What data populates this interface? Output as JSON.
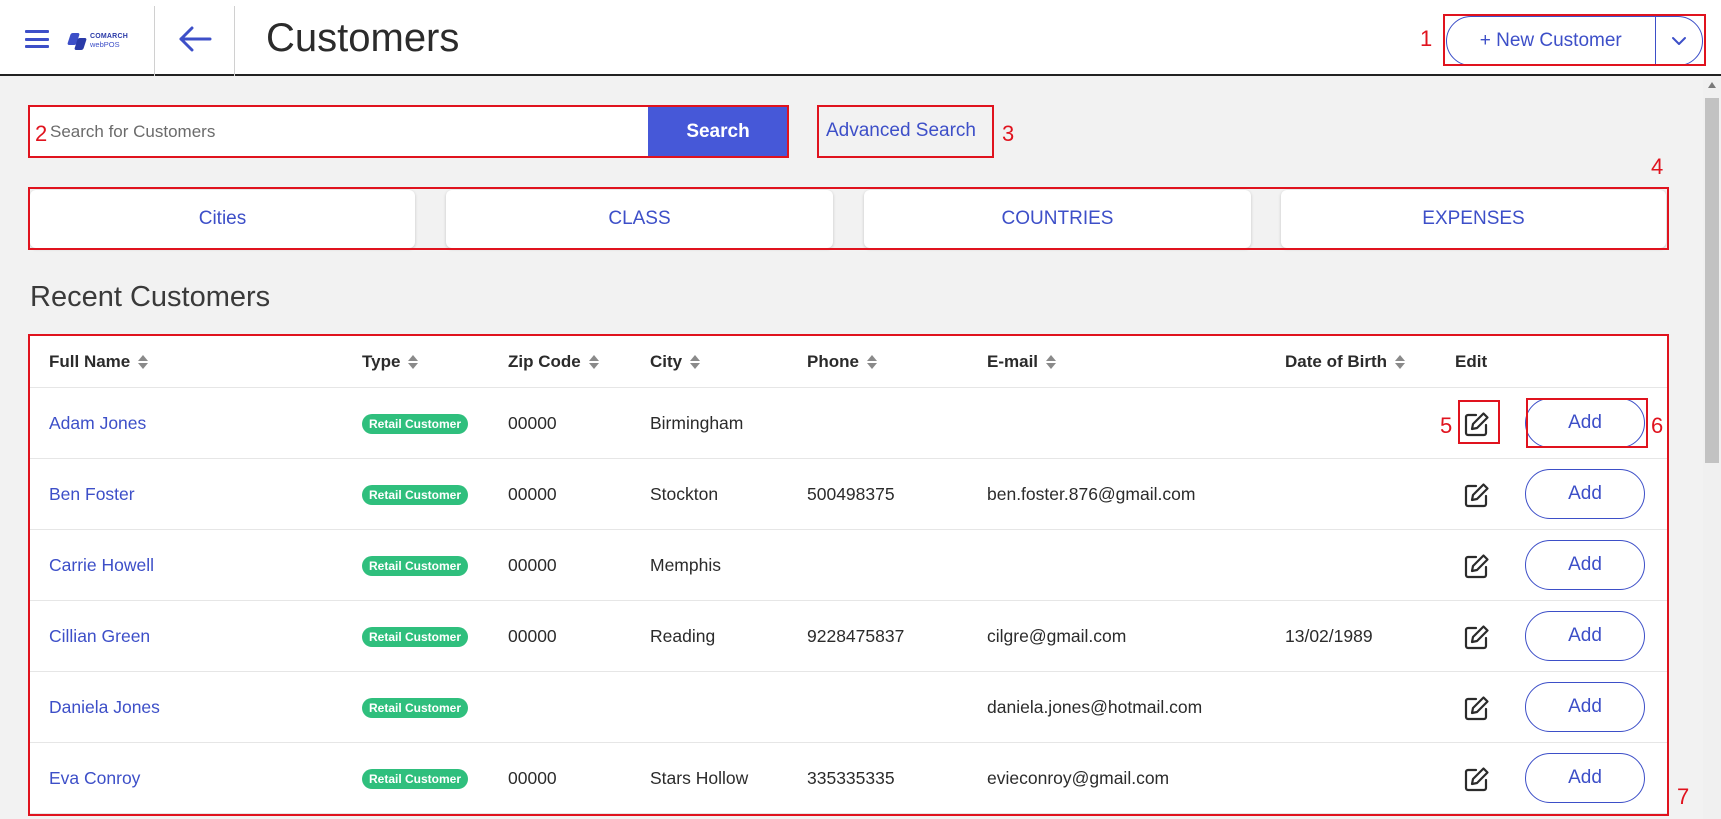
{
  "header": {
    "logo_line1": "COMARCH",
    "logo_line2": "webPOS",
    "title": "Customers",
    "new_customer_label": "+ New Customer"
  },
  "search": {
    "placeholder": "Search for Customers",
    "button_label": "Search",
    "advanced_label": "Advanced Search"
  },
  "categories": [
    "Cities",
    "CLASS",
    "COUNTRIES",
    "EXPENSES"
  ],
  "section_title": "Recent Customers",
  "table": {
    "columns": [
      "Full Name",
      "Type",
      "Zip Code",
      "City",
      "Phone",
      "E-mail",
      "Date of Birth",
      "Edit"
    ],
    "rows": [
      {
        "name": "Adam Jones",
        "type": "Retail Customer",
        "zip": "00000",
        "city": "Birmingham",
        "phone": "",
        "email": "",
        "dob": ""
      },
      {
        "name": "Ben Foster",
        "type": "Retail Customer",
        "zip": "00000",
        "city": "Stockton",
        "phone": "500498375",
        "email": "ben.foster.876@gmail.com",
        "dob": ""
      },
      {
        "name": "Carrie Howell",
        "type": "Retail Customer",
        "zip": "00000",
        "city": "Memphis",
        "phone": "",
        "email": "",
        "dob": ""
      },
      {
        "name": "Cillian Green",
        "type": "Retail Customer",
        "zip": "00000",
        "city": "Reading",
        "phone": "9228475837",
        "email": "cilgre@gmail.com",
        "dob": "13/02/1989"
      },
      {
        "name": "Daniela Jones",
        "type": "Retail Customer",
        "zip": "",
        "city": "",
        "phone": "",
        "email": "daniela.jones@hotmail.com",
        "dob": ""
      },
      {
        "name": "Eva Conroy",
        "type": "Retail Customer",
        "zip": "00000",
        "city": "Stars Hollow",
        "phone": "335335335",
        "email": "evieconroy@gmail.com",
        "dob": ""
      }
    ],
    "add_label": "Add"
  },
  "annotations": [
    "1",
    "2",
    "3",
    "4",
    "5",
    "6",
    "7"
  ],
  "colors": {
    "accent": "#3d4fc8",
    "search_button": "#4658d8",
    "badge": "#2fbf7d",
    "annotation": "#e0131e"
  },
  "icons": [
    "menu-icon",
    "comarch-logo-icon",
    "back-arrow-icon",
    "chevron-down-icon",
    "sort-icon",
    "edit-icon"
  ]
}
